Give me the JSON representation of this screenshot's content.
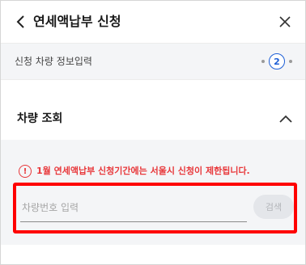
{
  "header": {
    "title": "연세액납부 신청"
  },
  "step": {
    "label": "신청 차량 정보입력",
    "current": "2"
  },
  "section": {
    "title": "차량 조회"
  },
  "notice": {
    "text": "1월 연세액납부 신청기간에는 서울시 신청이 제한됩니다."
  },
  "search": {
    "placeholder": "차량번호 입력",
    "button_label": "검색"
  },
  "colors": {
    "accent": "#1e5fd6",
    "warning": "#e8373a",
    "highlight": "#ff0000",
    "panel_bg": "#f4f5f7"
  }
}
